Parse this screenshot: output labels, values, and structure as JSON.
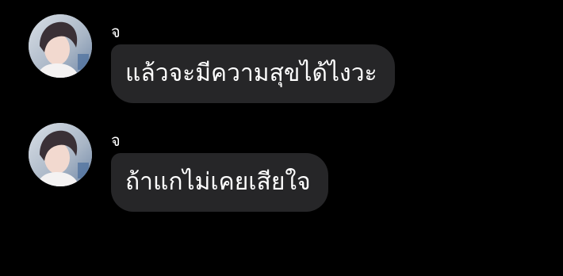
{
  "messages": [
    {
      "sender": "จ",
      "text": "แล้วจะมีความสุขได้ไงวะ",
      "avatar_icon": "profile-photo"
    },
    {
      "sender": "จ",
      "text": "ถ้าแกไม่เคยเสียใจ",
      "avatar_icon": "profile-photo"
    }
  ],
  "colors": {
    "background": "#000000",
    "bubble": "#262628",
    "text": "#ffffff"
  }
}
